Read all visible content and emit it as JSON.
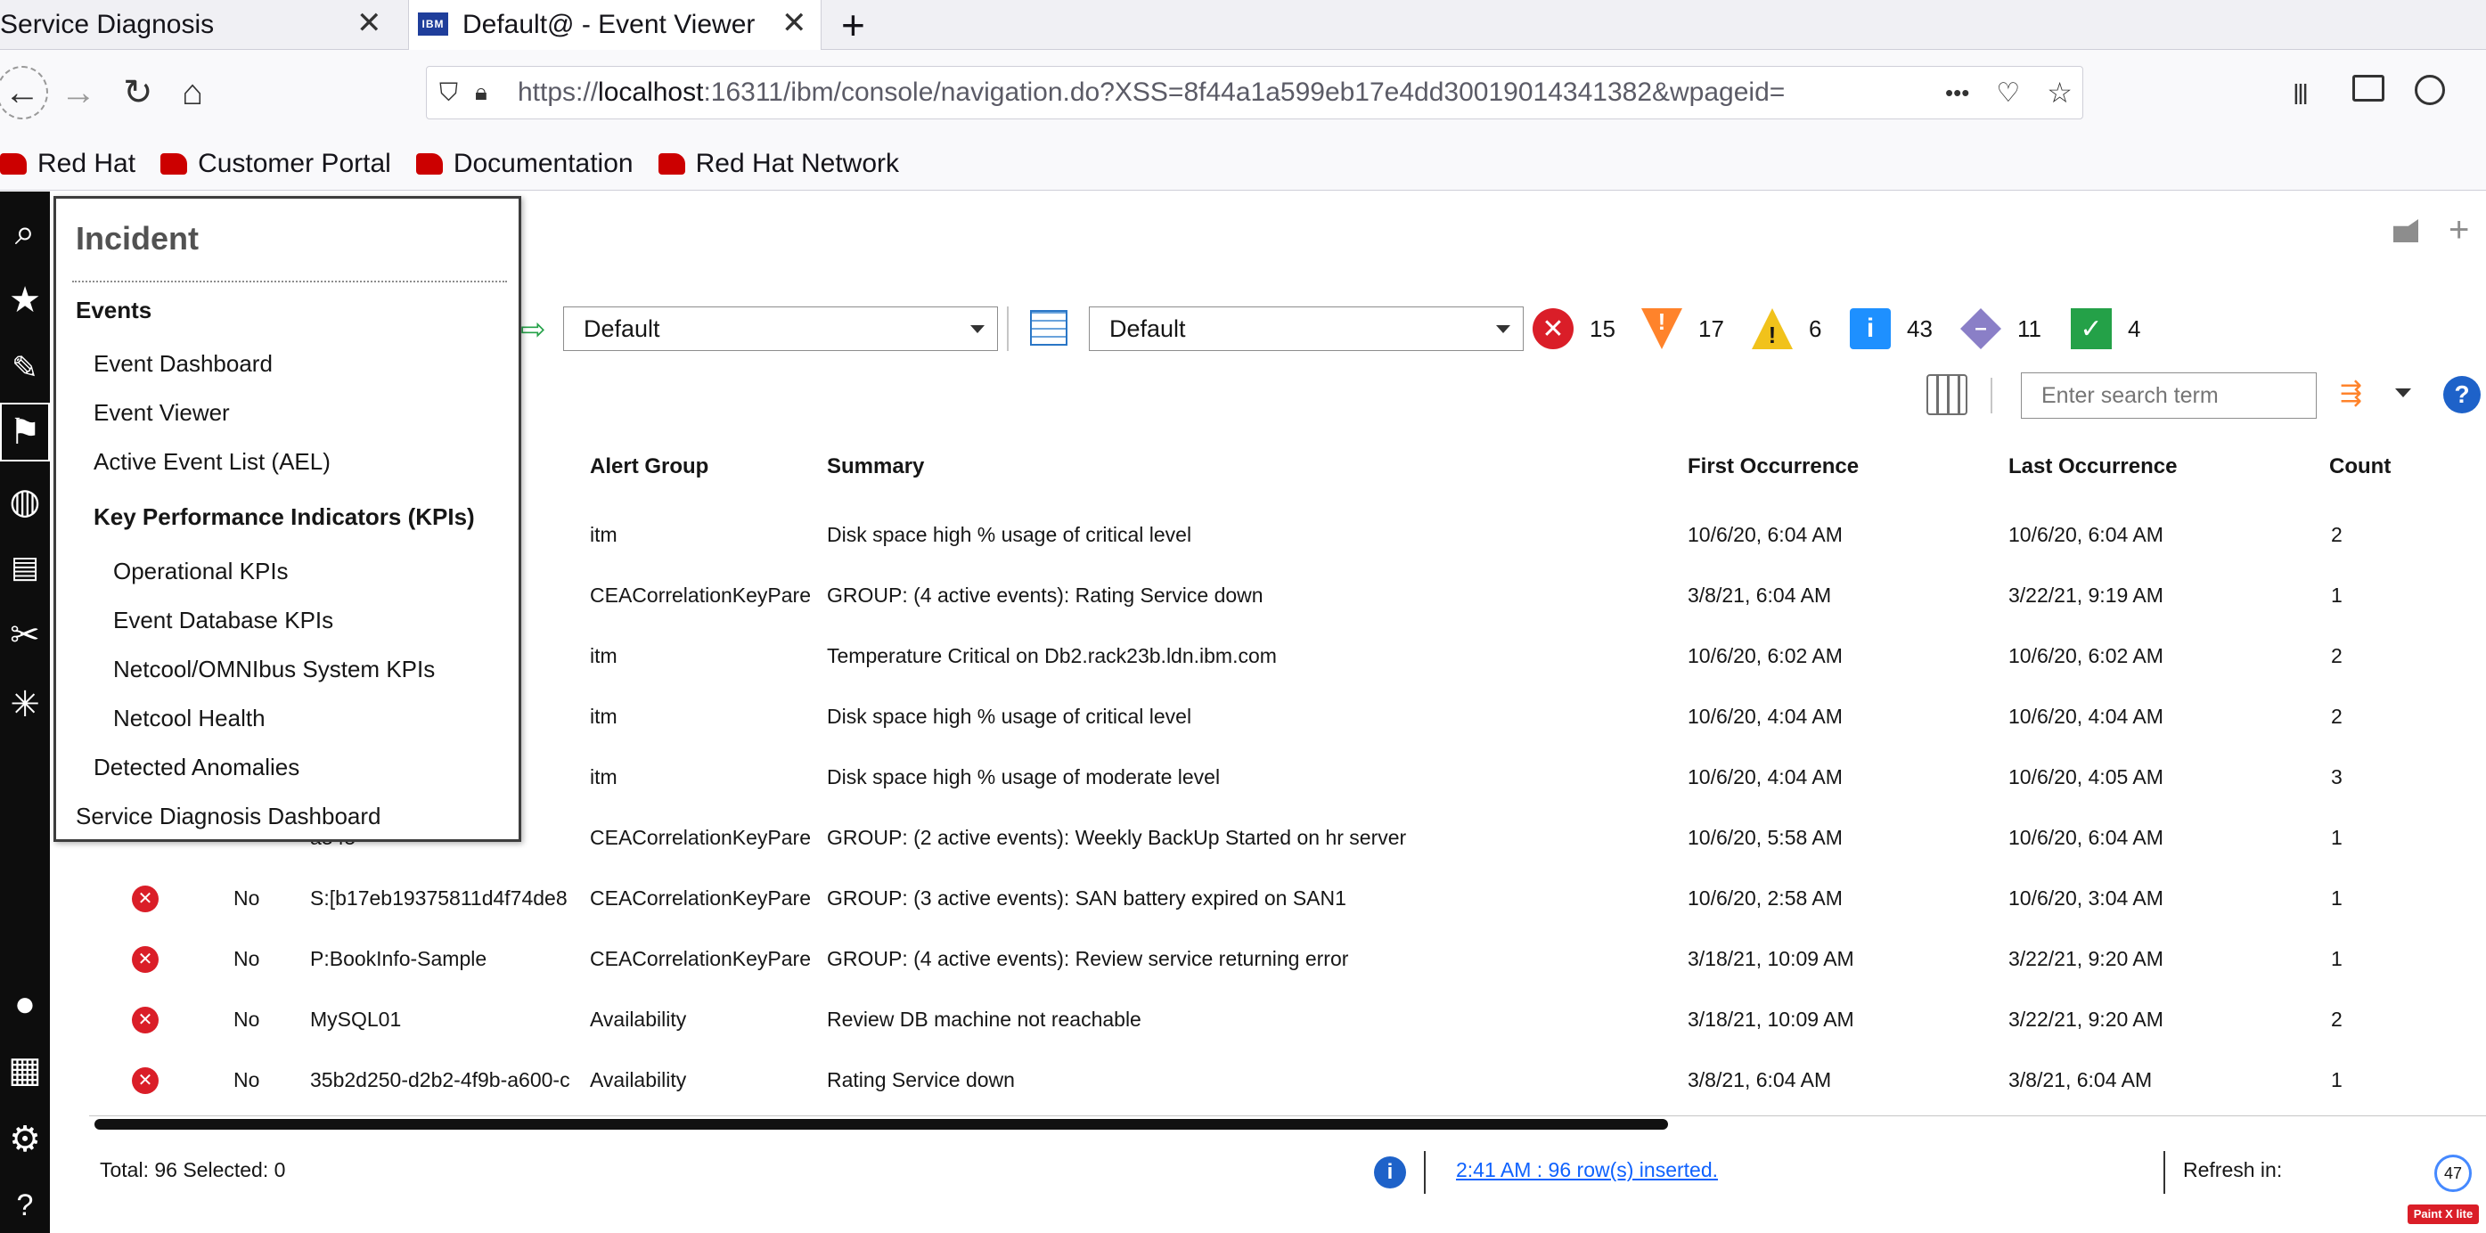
{
  "browser": {
    "tabs": [
      {
        "title": "Service Diagnosis",
        "active": false
      },
      {
        "title": "Default@ - Event Viewer",
        "active": true
      }
    ],
    "new_tab_label": "+",
    "url_prefix": "https://",
    "url_host": "localhost",
    "url_rest": ":16311/ibm/console/navigation.do?XSS=8f44a1a599eb17e4dd30019014341382&wpageid=",
    "url_more": "•••",
    "favicon_label": "IBM",
    "bookmarks": [
      "Red Hat",
      "Customer Portal",
      "Documentation",
      "Red Hat Network"
    ]
  },
  "toolbar": {
    "filter_value": "Default",
    "view_value": "Default",
    "severity_counts": [
      {
        "name": "critical",
        "count": "15",
        "color": "#da1e28",
        "icon": "x-icon"
      },
      {
        "name": "major",
        "count": "17",
        "color": "#ff832b",
        "icon": "exclamation-icon"
      },
      {
        "name": "minor",
        "count": "6",
        "color": "#f1c21b",
        "icon": "warning-icon"
      },
      {
        "name": "warning",
        "count": "43",
        "color": "#1e90ff",
        "icon": "info-icon"
      },
      {
        "name": "indeterminate",
        "count": "11",
        "color": "#8a7fc7",
        "icon": "diamond-icon"
      },
      {
        "name": "clear",
        "count": "4",
        "color": "#24a148",
        "icon": "check-icon"
      }
    ],
    "search_placeholder": "Enter search term"
  },
  "table": {
    "headers": {
      "alert_group": "Alert Group",
      "summary": "Summary",
      "first": "First Occurrence",
      "last": "Last Occurrence",
      "count": "Count"
    },
    "rows": [
      {
        "ack": "",
        "node": "",
        "alert_group": "itm",
        "summary": "Disk space high % usage of critical level",
        "first": "10/6/20, 6:04 AM",
        "last": "10/6/20, 6:04 AM",
        "count": "2"
      },
      {
        "ack": "",
        "node": "",
        "alert_group": "CEACorrelationKeyPare",
        "summary": "GROUP: (4 active events): Rating Service down",
        "first": "3/8/21, 6:04 AM",
        "last": "3/22/21, 9:19 AM",
        "count": "1"
      },
      {
        "ack": "",
        "node": "",
        "alert_group": "itm",
        "summary": "Temperature Critical on Db2.rack23b.ldn.ibm.com",
        "first": "10/6/20, 6:02 AM",
        "last": "10/6/20, 6:02 AM",
        "count": "2"
      },
      {
        "ack": "",
        "node": "",
        "alert_group": "itm",
        "summary": "Disk space high % usage of critical level",
        "first": "10/6/20, 4:04 AM",
        "last": "10/6/20, 4:04 AM",
        "count": "2"
      },
      {
        "ack": "",
        "node": "",
        "alert_group": "itm",
        "summary": "Disk space high % usage of moderate level",
        "first": "10/6/20, 4:04 AM",
        "last": "10/6/20, 4:05 AM",
        "count": "3"
      },
      {
        "ack": "",
        "node": "a345·",
        "alert_group": "CEACorrelationKeyPare",
        "summary": "GROUP: (2 active events): Weekly BackUp Started on hr server",
        "first": "10/6/20, 5:58 AM",
        "last": "10/6/20, 6:04 AM",
        "count": "1"
      },
      {
        "ack": "No",
        "node": "S:[b17eb19375811d4f74de8",
        "alert_group": "CEACorrelationKeyPare",
        "summary": "GROUP: (3 active events): SAN battery expired on SAN1",
        "first": "10/6/20, 2:58 AM",
        "last": "10/6/20, 3:04 AM",
        "count": "1"
      },
      {
        "ack": "No",
        "node": "P:BookInfo-Sample",
        "alert_group": "CEACorrelationKeyPare",
        "summary": "GROUP: (4 active events): Review service returning error",
        "first": "3/18/21, 10:09 AM",
        "last": "3/22/21, 9:20 AM",
        "count": "1"
      },
      {
        "ack": "No",
        "node": "MySQL01",
        "alert_group": "Availability",
        "summary": "Review DB machine not reachable",
        "first": "3/18/21, 10:09 AM",
        "last": "3/22/21, 9:20 AM",
        "count": "2"
      },
      {
        "ack": "No",
        "node": "35b2d250-d2b2-4f9b-a600-c",
        "alert_group": "Availability",
        "summary": "Rating Service down",
        "first": "3/8/21, 6:04 AM",
        "last": "3/8/21, 6:04 AM",
        "count": "1"
      }
    ]
  },
  "footer": {
    "totals": "Total: 96 Selected: 0",
    "status_link": "2:41 AM : 96 row(s) inserted.",
    "refresh_label": "Refresh in:",
    "refresh_seconds": "47",
    "watermark": "Paint X lite"
  },
  "incident_menu": {
    "title": "Incident",
    "events_heading": "Events",
    "event_dashboard": "Event Dashboard",
    "event_viewer": "Event Viewer",
    "active_event_list": "Active Event List (AEL)",
    "kpi_heading": "Key Performance Indicators (KPIs)",
    "operational_kpis": "Operational KPIs",
    "event_db_kpis": "Event Database KPIs",
    "netcool_system_kpis": "Netcool/OMNIbus System KPIs",
    "netcool_health": "Netcool Health",
    "detected_anomalies": "Detected Anomalies",
    "service_diagnosis_dashboard": "Service Diagnosis Dashboard"
  }
}
